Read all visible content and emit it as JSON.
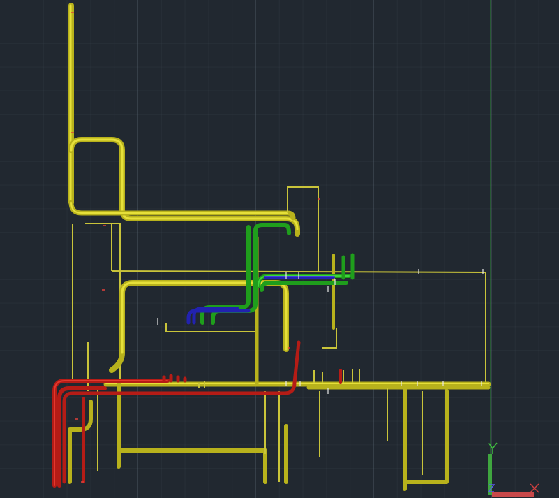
{
  "viewport": {
    "background_color": "#212830",
    "grid_color": "#78879a",
    "pipe_colors": {
      "yellow": "#d4cf2e",
      "red": "#d42a22",
      "green": "#2ec42a",
      "blue": "#3434d8"
    }
  },
  "ucs_icon": {
    "y_axis_label": "Y",
    "z_axis_label": "Z",
    "x_axis_color": "#c8494a",
    "y_axis_color": "#3fa63f"
  },
  "crosshair_cursor": {
    "icon": "crosshair-icon"
  }
}
